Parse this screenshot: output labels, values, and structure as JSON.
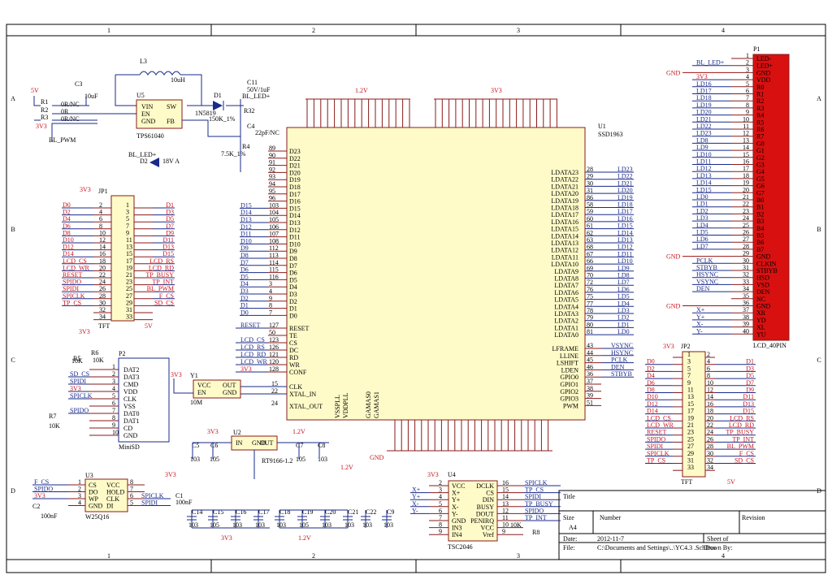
{
  "border": {
    "cols": [
      "1",
      "2",
      "3",
      "4"
    ],
    "rows": [
      "A",
      "B",
      "C",
      "D"
    ]
  },
  "title_block": {
    "title_label": "Title",
    "size_label": "Size",
    "size_value": "A4",
    "number_label": "Number",
    "revision_label": "Revision",
    "date_label": "Date:",
    "date_value": "2012-11-7",
    "sheet_label": "Sheet   of",
    "file_label": "File:",
    "file_value": "C:\\Documents and Settings\\..\\YC4.3   .SchDoc",
    "drawn_label": "Drawn By:"
  },
  "power": {
    "u5": "U5",
    "u5_part": "TPS61040",
    "u5_pins": [
      "VIN",
      "EN",
      "GND",
      "SW",
      "FB"
    ],
    "l3": "L3",
    "l3_val": "10uH",
    "d1": "D1",
    "d1_part": "1N5819",
    "r1": "R1",
    "r1_val": "0R/NC",
    "r2": "R2",
    "r2_val": "0R",
    "r3": "R3",
    "r3_val": "0R/NC",
    "c3": "C3",
    "c3_val": "10uF",
    "c11": "C11",
    "c11_val": "50V/1uF",
    "r32": "R32",
    "r32_val": "150K_1%",
    "c4": "C4",
    "c4_val": "22pF/NC",
    "r4": "R4",
    "r4_val": "7.5K_1%",
    "bl_pwm": "BL_PWM",
    "bl_led": "BL_LED+",
    "bl_led2": "BL_LED+",
    "d2": "D2",
    "d2_part": "18V A",
    "v5": "5V",
    "v3": "3V3"
  },
  "u1": {
    "ref": "U1",
    "part": "SSD1963",
    "vddd_top": [
      "89",
      "90",
      "91",
      "92",
      "93",
      "94",
      "95",
      "96",
      "97",
      "98",
      "99",
      "100"
    ],
    "left_pins": [
      {
        "num": "89",
        "name": "D23"
      },
      {
        "num": "90",
        "name": "D22"
      },
      {
        "num": "91",
        "name": "D21"
      },
      {
        "num": "92",
        "name": "D20"
      },
      {
        "num": "93",
        "name": "D19"
      },
      {
        "num": "94",
        "name": "D18"
      },
      {
        "num": "95",
        "name": "D17"
      },
      {
        "num": "96",
        "name": "D16"
      },
      {
        "num": "103",
        "name": "D15",
        "net": "D15"
      },
      {
        "num": "104",
        "name": "D14",
        "net": "D14"
      },
      {
        "num": "105",
        "name": "D13",
        "net": "D13"
      },
      {
        "num": "106",
        "name": "D12",
        "net": "D12"
      },
      {
        "num": "107",
        "name": "D11",
        "net": "D11"
      },
      {
        "num": "108",
        "name": "D10",
        "net": "D10"
      },
      {
        "num": "112",
        "name": "D9",
        "net": "D9"
      },
      {
        "num": "113",
        "name": "D8",
        "net": "D8"
      },
      {
        "num": "114",
        "name": "D7",
        "net": "D7"
      },
      {
        "num": "115",
        "name": "D6",
        "net": "D6"
      },
      {
        "num": "116",
        "name": "D5",
        "net": "D5"
      },
      {
        "num": "3",
        "name": "D4",
        "net": "D4"
      },
      {
        "num": "4",
        "name": "D3",
        "net": "D3"
      },
      {
        "num": "9",
        "name": "D2",
        "net": "D2"
      },
      {
        "num": "8",
        "name": "D1",
        "net": "D1"
      },
      {
        "num": "7",
        "name": "D0",
        "net": "D0"
      }
    ],
    "ctrl_pins": [
      {
        "num": "127",
        "name": "RESET",
        "net": "RESET"
      },
      {
        "num": "50",
        "name": "TE",
        "net": ""
      },
      {
        "num": "123",
        "name": "CS",
        "net": "LCD_CS"
      },
      {
        "num": "126",
        "name": "DC",
        "net": "LCD_RS"
      },
      {
        "num": "121",
        "name": "RD",
        "net": "LCD_RD"
      },
      {
        "num": "120",
        "name": "WR",
        "net": "LCD_WR"
      },
      {
        "num": "128",
        "name": "CONF",
        "net": "3V3"
      }
    ],
    "clk_pins": [
      {
        "num": "15",
        "name": "CLK"
      },
      {
        "num": "22",
        "name": "XTAL_IN"
      },
      {
        "num": "24",
        "name": "XTAL_OUT"
      }
    ],
    "right_pins": [
      {
        "num": "28",
        "name": "LDATA23",
        "net": "LD23"
      },
      {
        "num": "29",
        "name": "LDATA22",
        "net": "LD22"
      },
      {
        "num": "30",
        "name": "LDATA21",
        "net": "LD21"
      },
      {
        "num": "31",
        "name": "LDATA20",
        "net": "LD20"
      },
      {
        "num": "86",
        "name": "LDATA19",
        "net": "LD19"
      },
      {
        "num": "58",
        "name": "LDATA18",
        "net": "LD18"
      },
      {
        "num": "59",
        "name": "LDATA17",
        "net": "LD17"
      },
      {
        "num": "60",
        "name": "LDATA16",
        "net": "LD16"
      },
      {
        "num": "61",
        "name": "LDATA15",
        "net": "LD15"
      },
      {
        "num": "62",
        "name": "LDATA14",
        "net": "LD14"
      },
      {
        "num": "63",
        "name": "LDATA13",
        "net": "LD13"
      },
      {
        "num": "68",
        "name": "LDATA12",
        "net": "LD12"
      },
      {
        "num": "67",
        "name": "LDATA11",
        "net": "LD11"
      },
      {
        "num": "66",
        "name": "LDATA10",
        "net": "LD10"
      },
      {
        "num": "69",
        "name": "LDATA9",
        "net": "LD9"
      },
      {
        "num": "70",
        "name": "LDATA8",
        "net": "LD8"
      },
      {
        "num": "72",
        "name": "LDATA7",
        "net": "LD7"
      },
      {
        "num": "76",
        "name": "LDATA6",
        "net": "LD6"
      },
      {
        "num": "75",
        "name": "LDATA5",
        "net": "LD5"
      },
      {
        "num": "77",
        "name": "LDATA4",
        "net": "LD4"
      },
      {
        "num": "78",
        "name": "LDATA3",
        "net": "LD3"
      },
      {
        "num": "79",
        "name": "LDATA2",
        "net": "LD2"
      },
      {
        "num": "80",
        "name": "LDATA1",
        "net": "LD1"
      },
      {
        "num": "81",
        "name": "LDATA0",
        "net": "LD0"
      }
    ],
    "right_ctrl": [
      {
        "num": "43",
        "name": "LFRAME",
        "net": "VSYNC"
      },
      {
        "num": "44",
        "name": "LLINE",
        "net": "HSYNC"
      },
      {
        "num": "45",
        "name": "LSHIFT",
        "net": "PCLK"
      },
      {
        "num": "46",
        "name": "LDEN",
        "net": "DEN"
      },
      {
        "num": "36",
        "name": "GPIO0",
        "net": "STBYB"
      },
      {
        "num": "37",
        "name": "GPIO1",
        "net": ""
      },
      {
        "num": "38",
        "name": "GPIO2",
        "net": ""
      },
      {
        "num": "39",
        "name": "GPIO3",
        "net": ""
      },
      {
        "num": "51",
        "name": "PWM",
        "net": ""
      }
    ],
    "bottom_labels": [
      "VSSPLL",
      "VDDPLL",
      "GAMAS0",
      "GAMAS1"
    ],
    "v12": "1.2V",
    "v33": "3V3",
    "v12b": "1.2V"
  },
  "jp1": {
    "ref": "JP1",
    "part": "TFT",
    "rows": [
      {
        "l": "D0",
        "ln": "2",
        "rn": "1",
        "r": "D1"
      },
      {
        "l": "D2",
        "ln": "4",
        "rn": "3",
        "r": "D3"
      },
      {
        "l": "D4",
        "ln": "6",
        "rn": "5",
        "r": "D5"
      },
      {
        "l": "D6",
        "ln": "8",
        "rn": "7",
        "r": "D7"
      },
      {
        "l": "D8",
        "ln": "10",
        "rn": "9",
        "r": "D9"
      },
      {
        "l": "D10",
        "ln": "12",
        "rn": "11",
        "r": "D11"
      },
      {
        "l": "D12",
        "ln": "14",
        "rn": "13",
        "r": "D13"
      },
      {
        "l": "D14",
        "ln": "16",
        "rn": "15",
        "r": "D15"
      },
      {
        "l": "LCD_CS",
        "ln": "18",
        "rn": "17",
        "r": "LCD_RS"
      },
      {
        "l": "LCD_WR",
        "ln": "20",
        "rn": "19",
        "r": "LCD_RD"
      },
      {
        "l": "RESET",
        "ln": "22",
        "rn": "21",
        "r": "TP_BUSY"
      },
      {
        "l": "SPIDO",
        "ln": "24",
        "rn": "23",
        "r": "TP_INT"
      },
      {
        "l": "SPIDI",
        "ln": "26",
        "rn": "25",
        "r": "BL_PWM"
      },
      {
        "l": "SPICLK",
        "ln": "28",
        "rn": "27",
        "r": "F_CS"
      },
      {
        "l": "TP_CS",
        "ln": "30",
        "rn": "29",
        "r": "SD_CS"
      },
      {
        "l": "",
        "ln": "32",
        "rn": "31",
        "r": ""
      },
      {
        "l": "",
        "ln": "34",
        "rn": "33",
        "r": ""
      }
    ],
    "v33": "3V3",
    "v5": "5V"
  },
  "jp2": {
    "ref": "JP2",
    "part": "TFT",
    "rows": [
      {
        "l": "",
        "ln": "1",
        "rn": "2",
        "r": ""
      },
      {
        "l": "D0",
        "ln": "3",
        "rn": "4",
        "r": "D1"
      },
      {
        "l": "D2",
        "ln": "5",
        "rn": "6",
        "r": "D3"
      },
      {
        "l": "D4",
        "ln": "7",
        "rn": "8",
        "r": "D5"
      },
      {
        "l": "D6",
        "ln": "9",
        "rn": "10",
        "r": "D7"
      },
      {
        "l": "D8",
        "ln": "11",
        "rn": "12",
        "r": "D9"
      },
      {
        "l": "D10",
        "ln": "13",
        "rn": "14",
        "r": "D11"
      },
      {
        "l": "D12",
        "ln": "15",
        "rn": "16",
        "r": "D13"
      },
      {
        "l": "D14",
        "ln": "17",
        "rn": "18",
        "r": "D15"
      },
      {
        "l": "LCD_CS",
        "ln": "19",
        "rn": "20",
        "r": "LCD_RS"
      },
      {
        "l": "LCD_WR",
        "ln": "21",
        "rn": "22",
        "r": "LCD_RD"
      },
      {
        "l": "RESET",
        "ln": "23",
        "rn": "24",
        "r": "TP_BUSY"
      },
      {
        "l": "SPIDO",
        "ln": "25",
        "rn": "26",
        "r": "TP_INT"
      },
      {
        "l": "SPIDI",
        "ln": "27",
        "rn": "28",
        "r": "BL_PWM"
      },
      {
        "l": "SPICLK",
        "ln": "29",
        "rn": "30",
        "r": "F_CS"
      },
      {
        "l": "TP_CS",
        "ln": "31",
        "rn": "32",
        "r": "SD_CS"
      },
      {
        "l": "",
        "ln": "33",
        "rn": "34",
        "r": ""
      }
    ],
    "v33": "3V3",
    "v5": "5V"
  },
  "p1": {
    "ref": "P1",
    "part": "LCD_40PIN",
    "pins": [
      {
        "n": "1",
        "name": "LED-",
        "net": ""
      },
      {
        "n": "2",
        "name": "LED+",
        "net": "BL_LED+"
      },
      {
        "n": "3",
        "name": "GND",
        "net": ""
      },
      {
        "n": "4",
        "name": "VDD",
        "net": "3V3"
      },
      {
        "n": "5",
        "name": "R0",
        "net": "LD16"
      },
      {
        "n": "6",
        "name": "R1",
        "net": "LD17"
      },
      {
        "n": "7",
        "name": "R2",
        "net": "LD18"
      },
      {
        "n": "8",
        "name": "R3",
        "net": "LD19"
      },
      {
        "n": "9",
        "name": "R4",
        "net": "LD20"
      },
      {
        "n": "10",
        "name": "R5",
        "net": "LD21"
      },
      {
        "n": "11",
        "name": "R6",
        "net": "LD22"
      },
      {
        "n": "12",
        "name": "R7",
        "net": "LD23"
      },
      {
        "n": "13",
        "name": "G0",
        "net": "LD8"
      },
      {
        "n": "14",
        "name": "G1",
        "net": "LD9"
      },
      {
        "n": "15",
        "name": "G2",
        "net": "LD10"
      },
      {
        "n": "16",
        "name": "G3",
        "net": "LD11"
      },
      {
        "n": "17",
        "name": "G4",
        "net": "LD12"
      },
      {
        "n": "18",
        "name": "G5",
        "net": "LD13"
      },
      {
        "n": "19",
        "name": "G6",
        "net": "LD14"
      },
      {
        "n": "20",
        "name": "G7",
        "net": "LD15"
      },
      {
        "n": "21",
        "name": "B0",
        "net": "LD0"
      },
      {
        "n": "22",
        "name": "B1",
        "net": "LD1"
      },
      {
        "n": "23",
        "name": "B2",
        "net": "LD2"
      },
      {
        "n": "24",
        "name": "B3",
        "net": "LD3"
      },
      {
        "n": "25",
        "name": "B4",
        "net": "LD4"
      },
      {
        "n": "26",
        "name": "B5",
        "net": "LD5"
      },
      {
        "n": "27",
        "name": "B6",
        "net": "LD6"
      },
      {
        "n": "28",
        "name": "B7",
        "net": "LD7"
      },
      {
        "n": "29",
        "name": "GND",
        "net": ""
      },
      {
        "n": "30",
        "name": "CLKIN",
        "net": "PCLK"
      },
      {
        "n": "31",
        "name": "STBYB",
        "net": "STBYB"
      },
      {
        "n": "32",
        "name": "HSD",
        "net": "HSYNC"
      },
      {
        "n": "33",
        "name": "VSD",
        "net": "VSYNC"
      },
      {
        "n": "34",
        "name": "DEN",
        "net": "DEN"
      },
      {
        "n": "35",
        "name": "NC",
        "net": ""
      },
      {
        "n": "36",
        "name": "GND",
        "net": ""
      },
      {
        "n": "37",
        "name": "XR",
        "net": "X+"
      },
      {
        "n": "38",
        "name": "YD",
        "net": "Y+"
      },
      {
        "n": "39",
        "name": "XL",
        "net": "X-"
      },
      {
        "n": "40",
        "name": "YU",
        "net": "Y-"
      }
    ]
  },
  "p2": {
    "ref": "P2",
    "part": "MiniSD",
    "pins": [
      {
        "n": "1",
        "name": "DAT2",
        "net": ""
      },
      {
        "n": "2",
        "name": "DAT3",
        "net": "SD_CS"
      },
      {
        "n": "3",
        "name": "CMD",
        "net": "SPIDI"
      },
      {
        "n": "4",
        "name": "VDD",
        "net": "3V3"
      },
      {
        "n": "5",
        "name": "CLK",
        "net": "SPICLK"
      },
      {
        "n": "6",
        "name": "VSS",
        "net": ""
      },
      {
        "n": "7",
        "name": "DAT0",
        "net": "SPIDO"
      },
      {
        "n": "8",
        "name": "DAT1",
        "net": ""
      },
      {
        "n": "9",
        "name": "CD",
        "net": ""
      },
      {
        "n": "10",
        "name": "GND",
        "net": ""
      }
    ],
    "r5": "R5",
    "r5_val": "10K",
    "r6": "R6",
    "r6_val": "10K",
    "r7": "R7",
    "r7_val": "10K",
    "v33": "3V3"
  },
  "y1": {
    "ref": "Y1",
    "part": "10M",
    "pins": [
      "VCC",
      "EN",
      "OUT",
      "GND"
    ],
    "v33": "3V3"
  },
  "u2": {
    "ref": "U2",
    "part": "RT9166-1.2",
    "pins": [
      "IN",
      "GND",
      "OUT"
    ],
    "c5": "C5",
    "c6": "C6",
    "c7": "C7",
    "c8": "C8",
    "c9": "C9",
    "cv": "105",
    "cv2": "103",
    "v33": "3V3",
    "v12": "1.2V"
  },
  "u3": {
    "ref": "U3",
    "part": "W25Q16",
    "pins_l": [
      "CS",
      "DO",
      "WP",
      "GND"
    ],
    "pins_r": [
      "VCC",
      "HOLD",
      "CLK",
      "DI"
    ],
    "nums_l": [
      "1",
      "2",
      "3",
      "4"
    ],
    "nums_r": [
      "8",
      "7",
      "6",
      "5"
    ],
    "nets_l": [
      "F_CS",
      "SPIDO",
      "3V3",
      ""
    ],
    "nets_r": [
      "",
      "",
      "SPICLK",
      "SPIDI"
    ],
    "c1": "C1",
    "c1_val": "100nF",
    "c2": "C2",
    "c2_val": "100nF",
    "v33": "3V3"
  },
  "decoupling": {
    "caps": [
      "C14",
      "C15",
      "C16",
      "C17",
      "C18",
      "C19",
      "C20",
      "C21",
      "C22",
      "C9",
      "C10"
    ],
    "vals": [
      "103",
      "105",
      "103",
      "103",
      "103",
      "105",
      "103",
      "103",
      "103",
      "103",
      "103"
    ],
    "v33": "3V3",
    "v12": "1.2V"
  },
  "u4": {
    "ref": "U4",
    "part": "TSC2046",
    "pins_l": [
      {
        "n": "2",
        "name": "VCC",
        "net": ""
      },
      {
        "n": "3",
        "name": "X+",
        "net": "X+"
      },
      {
        "n": "4",
        "name": "Y+",
        "net": "Y+"
      },
      {
        "n": "5",
        "name": "X-",
        "net": "X-"
      },
      {
        "n": "6",
        "name": "Y-",
        "net": "Y-"
      },
      {
        "n": "7",
        "name": "GND",
        "net": ""
      },
      {
        "n": "8",
        "name": "IN3",
        "net": ""
      },
      {
        "n": "9",
        "name": "IN4",
        "net": ""
      }
    ],
    "pins_r": [
      {
        "n": "16",
        "name": "DCLK",
        "net": "SPICLK"
      },
      {
        "n": "15",
        "name": "CS",
        "net": "TP_CS"
      },
      {
        "n": "14",
        "name": "DIN",
        "net": "SPIDI"
      },
      {
        "n": "13",
        "name": "BUSY",
        "net": "TP_BUSY"
      },
      {
        "n": "12",
        "name": "DOUT",
        "net": "SPIDO"
      },
      {
        "n": "11",
        "name": "PENIRQ",
        "net": "TP_INT"
      },
      {
        "n": "10",
        "name": "VCC",
        "net": ""
      },
      {
        "n": "9",
        "name": "Vref",
        "net": ""
      }
    ],
    "r8": "R8",
    "r8_val": "10K",
    "v33": "3V3"
  },
  "gnd": "GND"
}
